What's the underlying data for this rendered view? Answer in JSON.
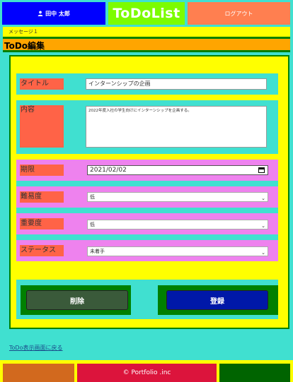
{
  "header": {
    "user_name": "田中 太郎",
    "app_title": "ToDoList",
    "logout_label": "ログアウト"
  },
  "message_bar": {
    "text": "メッセージ１"
  },
  "page": {
    "title": "ToDo編集"
  },
  "form": {
    "title": {
      "label": "タイトル",
      "value": "インターンシップの企画"
    },
    "content": {
      "label": "内容",
      "value": "2022年度入社の学生向けにインターンシップを企画する。"
    },
    "deadline": {
      "label": "期限",
      "value": "2021/02/02"
    },
    "difficulty": {
      "label": "難易度",
      "selected": "低"
    },
    "importance": {
      "label": "重要度",
      "selected": "低"
    },
    "status": {
      "label": "ステータス",
      "selected": "未着手"
    }
  },
  "actions": {
    "delete_label": "削除",
    "register_label": "登録"
  },
  "back_link": "ToDo表示画面に戻る",
  "footer": {
    "copyright": "© Portfolio .inc"
  },
  "colors": {
    "header_bg": "#40e0d0",
    "user_btn": "#0000ff",
    "title_bg": "#7cfc00",
    "logout_btn": "#ff7f50",
    "label_bg": "#ff6347",
    "pink_row": "#ee82ee",
    "register_btn": "#0018a8"
  },
  "icons": {
    "user": "user-icon",
    "calendar": "calendar-icon",
    "dropdown": "chevron-down-icon"
  }
}
